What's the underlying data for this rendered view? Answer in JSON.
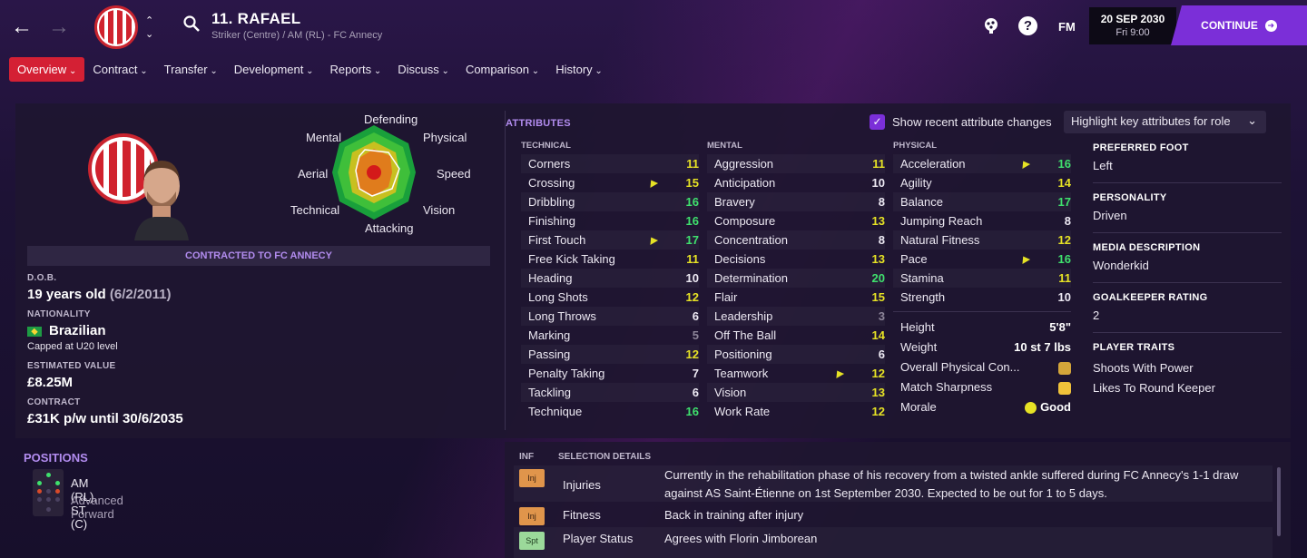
{
  "header": {
    "player_title": "11. RAFAEL",
    "player_subtitle": "Striker (Centre) / AM (RL) - FC Annecy",
    "date": "20 SEP 2030",
    "time": "Fri 9:00",
    "continue_label": "CONTINUE",
    "fm_label": "FM",
    "help_label": "?"
  },
  "tabs": [
    "Overview",
    "Contract",
    "Transfer",
    "Development",
    "Reports",
    "Discuss",
    "Comparison",
    "History"
  ],
  "radar": {
    "labels": {
      "defending": "Defending",
      "physical": "Physical",
      "speed": "Speed",
      "vision": "Vision",
      "attacking": "Attacking",
      "technical": "Technical",
      "aerial": "Aerial",
      "mental": "Mental"
    }
  },
  "profile": {
    "contract_banner": "CONTRACTED TO FC ANNECY",
    "dob_label": "D.O.B.",
    "age": "19 years old",
    "dob": "(6/2/2011)",
    "nationality_label": "NATIONALITY",
    "nationality": "Brazilian",
    "caps": "Capped at U20 level",
    "value_label": "ESTIMATED VALUE",
    "value": "£8.25M",
    "contract_label": "CONTRACT",
    "contract": "£31K p/w until 30/6/2035"
  },
  "attributes": {
    "title": "ATTRIBUTES",
    "show_changes_label": "Show recent attribute changes",
    "highlight_label": "Highlight key attributes for role",
    "technical_header": "TECHNICAL",
    "mental_header": "MENTAL",
    "physical_header": "PHYSICAL",
    "technical": [
      {
        "name": "Corners",
        "value": "11",
        "tone": "yellow",
        "arrow": false
      },
      {
        "name": "Crossing",
        "value": "15",
        "tone": "yellow",
        "arrow": true
      },
      {
        "name": "Dribbling",
        "value": "16",
        "tone": "green",
        "arrow": false
      },
      {
        "name": "Finishing",
        "value": "16",
        "tone": "green",
        "arrow": false
      },
      {
        "name": "First Touch",
        "value": "17",
        "tone": "green",
        "arrow": true
      },
      {
        "name": "Free Kick Taking",
        "value": "11",
        "tone": "yellow",
        "arrow": false
      },
      {
        "name": "Heading",
        "value": "10",
        "tone": "white",
        "arrow": false
      },
      {
        "name": "Long Shots",
        "value": "12",
        "tone": "yellow",
        "arrow": false
      },
      {
        "name": "Long Throws",
        "value": "6",
        "tone": "white",
        "arrow": false
      },
      {
        "name": "Marking",
        "value": "5",
        "tone": "grey",
        "arrow": false
      },
      {
        "name": "Passing",
        "value": "12",
        "tone": "yellow",
        "arrow": false
      },
      {
        "name": "Penalty Taking",
        "value": "7",
        "tone": "white",
        "arrow": false
      },
      {
        "name": "Tackling",
        "value": "6",
        "tone": "white",
        "arrow": false
      },
      {
        "name": "Technique",
        "value": "16",
        "tone": "green",
        "arrow": false
      }
    ],
    "mental": [
      {
        "name": "Aggression",
        "value": "11",
        "tone": "yellow",
        "arrow": false
      },
      {
        "name": "Anticipation",
        "value": "10",
        "tone": "white",
        "arrow": false
      },
      {
        "name": "Bravery",
        "value": "8",
        "tone": "white",
        "arrow": false
      },
      {
        "name": "Composure",
        "value": "13",
        "tone": "yellow",
        "arrow": false
      },
      {
        "name": "Concentration",
        "value": "8",
        "tone": "white",
        "arrow": false
      },
      {
        "name": "Decisions",
        "value": "13",
        "tone": "yellow",
        "arrow": false
      },
      {
        "name": "Determination",
        "value": "20",
        "tone": "green",
        "arrow": false
      },
      {
        "name": "Flair",
        "value": "15",
        "tone": "yellow",
        "arrow": false
      },
      {
        "name": "Leadership",
        "value": "3",
        "tone": "grey",
        "arrow": false
      },
      {
        "name": "Off The Ball",
        "value": "14",
        "tone": "yellow",
        "arrow": false
      },
      {
        "name": "Positioning",
        "value": "6",
        "tone": "white",
        "arrow": false
      },
      {
        "name": "Teamwork",
        "value": "12",
        "tone": "yellow",
        "arrow": true
      },
      {
        "name": "Vision",
        "value": "13",
        "tone": "yellow",
        "arrow": false
      },
      {
        "name": "Work Rate",
        "value": "12",
        "tone": "yellow",
        "arrow": false
      }
    ],
    "physical": [
      {
        "name": "Acceleration",
        "value": "16",
        "tone": "green",
        "arrow": true
      },
      {
        "name": "Agility",
        "value": "14",
        "tone": "yellow",
        "arrow": false
      },
      {
        "name": "Balance",
        "value": "17",
        "tone": "green",
        "arrow": false
      },
      {
        "name": "Jumping Reach",
        "value": "8",
        "tone": "white",
        "arrow": false
      },
      {
        "name": "Natural Fitness",
        "value": "12",
        "tone": "yellow",
        "arrow": false
      },
      {
        "name": "Pace",
        "value": "16",
        "tone": "green",
        "arrow": true
      },
      {
        "name": "Stamina",
        "value": "11",
        "tone": "yellow",
        "arrow": false
      },
      {
        "name": "Strength",
        "value": "10",
        "tone": "white",
        "arrow": false
      }
    ],
    "height_label": "Height",
    "height": "5'8\"",
    "weight_label": "Weight",
    "weight": "10 st 7 lbs",
    "condition_label": "Overall Physical Con...",
    "sharpness_label": "Match Sharpness",
    "morale_label": "Morale",
    "morale": "Good"
  },
  "info": {
    "foot_label": "PREFERRED FOOT",
    "foot": "Left",
    "personality_label": "PERSONALITY",
    "personality": "Driven",
    "media_label": "MEDIA DESCRIPTION",
    "media": "Wonderkid",
    "gk_label": "GOALKEEPER RATING",
    "gk": "2",
    "traits_label": "PLAYER TRAITS",
    "traits": [
      "Shoots With Power",
      "Likes To Round Keeper"
    ]
  },
  "positions": {
    "title": "POSITIONS",
    "main": "AM (RL), ST (C)",
    "role": "Advanced Forward"
  },
  "selection": {
    "inf_header": "INF",
    "details_header": "SELECTION DETAILS",
    "rows": [
      {
        "tag": "Inj",
        "name": "Injuries",
        "desc": "Currently in the rehabilitation phase of his recovery from a twisted ankle suffered during FC Annecy's 1-1 draw against AS Saint-Étienne on 1st September 2030. Expected to be out for 1 to 5 days."
      },
      {
        "tag": "Inj",
        "name": "Fitness",
        "desc": "Back in training after injury"
      },
      {
        "tag": "Spt",
        "name": "Player Status",
        "desc": "Agrees with Florin Jimborean"
      }
    ]
  },
  "colors": {
    "accent": "#7b2fd8",
    "tab_active": "#d42034",
    "attr_green": "#3fe06d",
    "attr_yellow": "#e6e225"
  }
}
